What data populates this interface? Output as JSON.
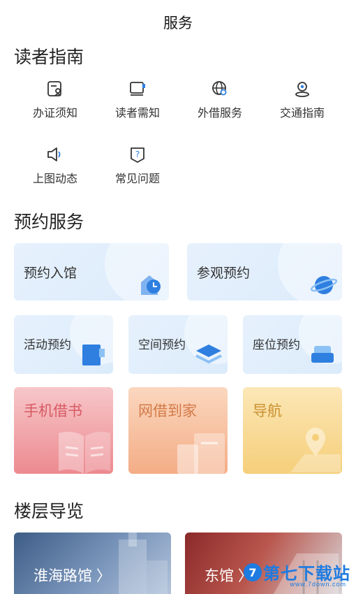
{
  "header": {
    "title": "服务"
  },
  "reader_guide": {
    "title": "读者指南",
    "items": [
      {
        "label": "办证须知",
        "icon": "id-card-icon"
      },
      {
        "label": "读者需知",
        "icon": "notice-board-icon"
      },
      {
        "label": "外借服务",
        "icon": "globe-search-icon"
      },
      {
        "label": "交通指南",
        "icon": "location-pin-icon"
      },
      {
        "label": "上图动态",
        "icon": "speaker-icon"
      },
      {
        "label": "常见问题",
        "icon": "question-icon"
      }
    ]
  },
  "reservation": {
    "title": "预约服务",
    "top": [
      {
        "label": "预约入馆",
        "icon": "building-clock-icon"
      },
      {
        "label": "参观预约",
        "icon": "planet-icon"
      }
    ],
    "middle": [
      {
        "label": "活动预约",
        "icon": "book-bookmark-icon"
      },
      {
        "label": "空间预约",
        "icon": "layers-icon"
      },
      {
        "label": "座位预约",
        "icon": "sofa-icon"
      }
    ],
    "big": [
      {
        "label": "手机借书",
        "icon": "open-book-icon"
      },
      {
        "label": "网借到家",
        "icon": "delivery-box-icon"
      },
      {
        "label": "导航",
        "icon": "map-pin-icon"
      }
    ]
  },
  "floor_guide": {
    "title": "楼层导览",
    "cards": [
      {
        "label": "淮海路馆 〉"
      },
      {
        "label": "东馆 〉"
      }
    ]
  },
  "watermark": {
    "text": "第七下载站",
    "url": "www.7down.com"
  },
  "colors": {
    "accent_blue": "#2f7fe0",
    "text": "#333333"
  }
}
